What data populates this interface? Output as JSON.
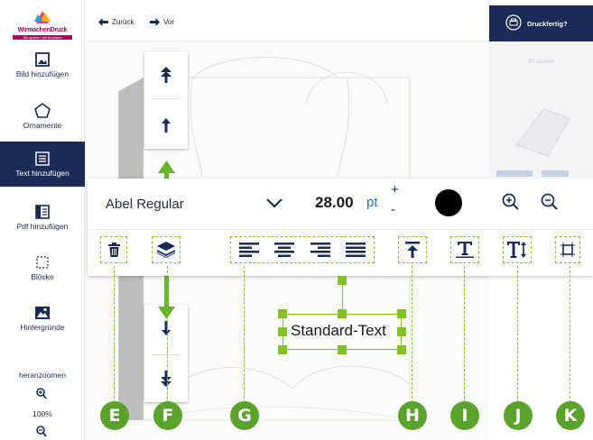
{
  "logo": {
    "text": "WirmachenDruck",
    "tagline": "Sie sparen, wir drucken!"
  },
  "topbar": {
    "back_label": "Zurück",
    "forward_label": "Vor"
  },
  "print": {
    "label": "Druckfertig?"
  },
  "preview": {
    "label": "3D-Ansicht"
  },
  "sidebar": {
    "items": [
      {
        "label": "Bild hinzufügen",
        "icon": "image-icon",
        "active": false
      },
      {
        "label": "Ornamente",
        "icon": "pentagon-icon",
        "active": false
      },
      {
        "label": "Text hinzufügen",
        "icon": "text-icon",
        "active": true
      },
      {
        "label": "Pdf hinzufügen",
        "icon": "pdf-icon",
        "active": false
      },
      {
        "label": "Blöcke",
        "icon": "block-icon",
        "active": false
      },
      {
        "label": "Hintergründe",
        "icon": "background-icon",
        "active": false
      }
    ],
    "zoom_label": "heranzoomen",
    "zoom_value": "100%"
  },
  "toolbar": {
    "font_name": "Abel Regular",
    "font_size": "28.00",
    "font_unit": "pt",
    "color": "#000000"
  },
  "canvas": {
    "text_value": "Standard-Text"
  },
  "callouts": [
    "E",
    "F",
    "G",
    "H",
    "I",
    "J",
    "K"
  ],
  "colors": {
    "accent": "#84c225",
    "navy": "#1b2b55",
    "callout": "#5ba22c"
  }
}
